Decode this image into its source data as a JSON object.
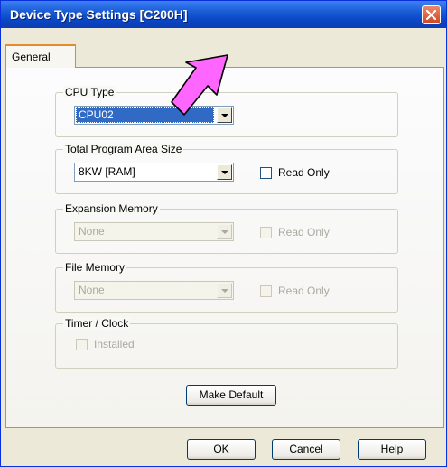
{
  "window": {
    "title": "Device Type Settings [C200H]"
  },
  "tabs": [
    {
      "label": "General"
    }
  ],
  "cpu_type": {
    "legend": "CPU Type",
    "value": "CPU02"
  },
  "program_area": {
    "legend": "Total Program Area Size",
    "value": "8KW [RAM]",
    "read_only_label": "Read Only"
  },
  "expansion_memory": {
    "legend": "Expansion Memory",
    "value": "None",
    "read_only_label": "Read Only"
  },
  "file_memory": {
    "legend": "File Memory",
    "value": "None",
    "read_only_label": "Read Only"
  },
  "timer_clock": {
    "legend": "Timer / Clock",
    "installed_label": "Installed"
  },
  "buttons": {
    "make_default": "Make Default",
    "ok": "OK",
    "cancel": "Cancel",
    "help": "Help"
  },
  "colors": {
    "title_bar": "#0a46c6",
    "highlight": "#316ac5",
    "annotation_arrow": "#ff66ff"
  },
  "icons": {
    "close": "close-icon",
    "dropdown": "chevron-down-icon"
  }
}
